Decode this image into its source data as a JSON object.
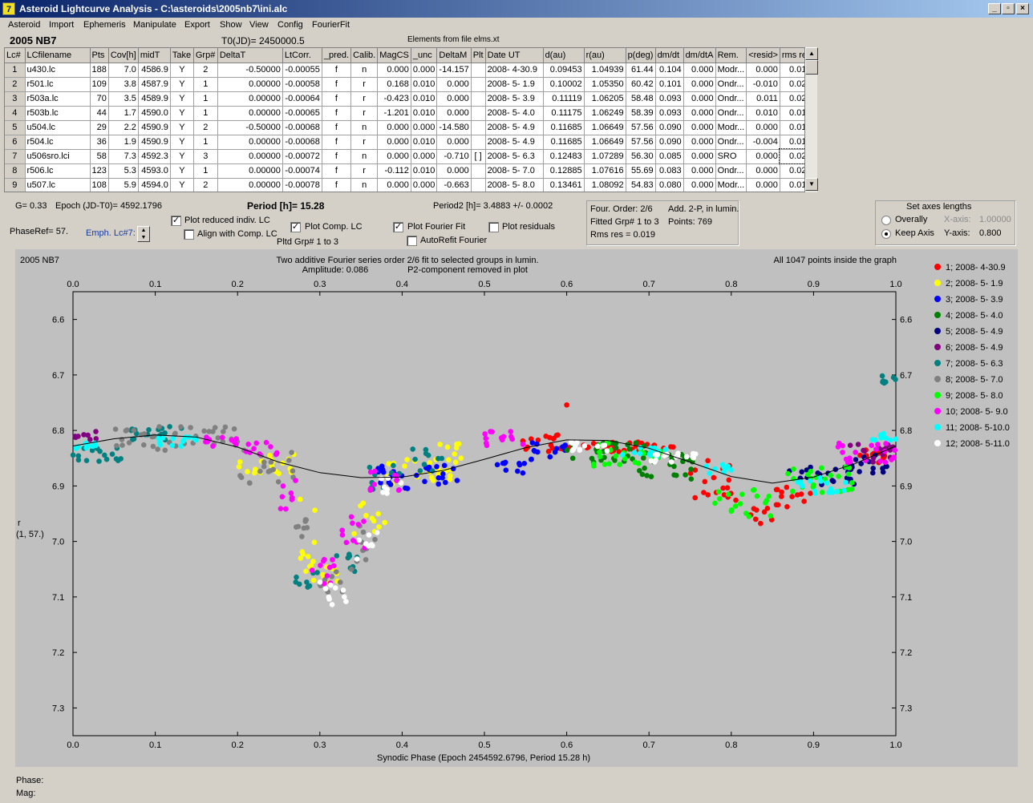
{
  "window": {
    "title": "Asteroid Lightcurve Analysis - C:\\asteroids\\2005nb7\\ini.alc",
    "min_label": "_",
    "max_label": "▫",
    "close_label": "×"
  },
  "menu": [
    "Asteroid",
    "Import",
    "Ephemeris",
    "Manipulate",
    "Export",
    "Show",
    "View",
    "Config",
    "FourierFit"
  ],
  "header": {
    "asteroid_name": "2005 NB7",
    "t0": "T0(JD)= 2450000.5",
    "elements": "Elements from file elms.xt"
  },
  "table": {
    "columns": [
      "Lc#",
      "LCfilename",
      "Pts",
      "Cov[h]",
      "midT",
      "Take",
      "Grp#",
      "DeltaT",
      "LtCorr.",
      "_pred.",
      "Calib.",
      "MagCS",
      "_unc",
      "DeltaM",
      "Plt",
      "Date UT",
      "d(au)",
      "r(au)",
      "p(deg)",
      "dm/dt",
      "dm/dtA",
      "Rem.",
      "<resid>",
      "rms res"
    ],
    "rows": [
      [
        "1",
        "u430.lc",
        "188",
        "7.0",
        "4586.9",
        "Y",
        "2",
        "-0.50000",
        "-0.00055",
        "f",
        "n",
        "0.000",
        "0.000",
        "-14.157",
        "",
        "2008- 4-30.9",
        "0.09453",
        "1.04939",
        "61.44",
        "0.104",
        "0.000",
        "Modr...",
        "0.000",
        "0.019"
      ],
      [
        "2",
        "r501.lc",
        "109",
        "3.8",
        "4587.9",
        "Y",
        "1",
        "0.00000",
        "-0.00058",
        "f",
        "r",
        "0.168",
        "0.010",
        "0.000",
        "",
        "2008- 5- 1.9",
        "0.10002",
        "1.05350",
        "60.42",
        "0.101",
        "0.000",
        "Ondr...",
        "-0.010",
        "0.023"
      ],
      [
        "3",
        "r503a.lc",
        "70",
        "3.5",
        "4589.9",
        "Y",
        "1",
        "0.00000",
        "-0.00064",
        "f",
        "r",
        "-0.423",
        "0.010",
        "0.000",
        "",
        "2008- 5- 3.9",
        "0.11119",
        "1.06205",
        "58.48",
        "0.093",
        "0.000",
        "Ondr...",
        "0.011",
        "0.022"
      ],
      [
        "4",
        "r503b.lc",
        "44",
        "1.7",
        "4590.0",
        "Y",
        "1",
        "0.00000",
        "-0.00065",
        "f",
        "r",
        "-1.201",
        "0.010",
        "0.000",
        "",
        "2008- 5- 4.0",
        "0.11175",
        "1.06249",
        "58.39",
        "0.093",
        "0.000",
        "Ondr...",
        "0.010",
        "0.017"
      ],
      [
        "5",
        "u504.lc",
        "29",
        "2.2",
        "4590.9",
        "Y",
        "2",
        "-0.50000",
        "-0.00068",
        "f",
        "n",
        "0.000",
        "0.000",
        "-14.580",
        "",
        "2008- 5- 4.9",
        "0.11685",
        "1.06649",
        "57.56",
        "0.090",
        "0.000",
        "Modr...",
        "0.000",
        "0.016"
      ],
      [
        "6",
        "r504.lc",
        "36",
        "1.9",
        "4590.9",
        "Y",
        "1",
        "0.00000",
        "-0.00068",
        "f",
        "r",
        "0.000",
        "0.010",
        "0.000",
        "",
        "2008- 5- 4.9",
        "0.11685",
        "1.06649",
        "57.56",
        "0.090",
        "0.000",
        "Ondr...",
        "-0.004",
        "0.014"
      ],
      [
        "7",
        "u506sro.lci",
        "58",
        "7.3",
        "4592.3",
        "Y",
        "3",
        "0.00000",
        "-0.00072",
        "f",
        "n",
        "0.000",
        "0.000",
        "-0.710",
        "[ ]",
        "2008- 5- 6.3",
        "0.12483",
        "1.07289",
        "56.30",
        "0.085",
        "0.000",
        "SRO",
        "0.000",
        "0.024"
      ],
      [
        "8",
        "r506.lc",
        "123",
        "5.3",
        "4593.0",
        "Y",
        "1",
        "0.00000",
        "-0.00074",
        "f",
        "r",
        "-0.112",
        "0.010",
        "0.000",
        "",
        "2008- 5- 7.0",
        "0.12885",
        "1.07616",
        "55.69",
        "0.083",
        "0.000",
        "Ondr...",
        "0.000",
        "0.022"
      ],
      [
        "9",
        "u507.lc",
        "108",
        "5.9",
        "4594.0",
        "Y",
        "2",
        "0.00000",
        "-0.00078",
        "f",
        "n",
        "0.000",
        "0.000",
        "-0.663",
        "",
        "2008- 5- 8.0",
        "0.13461",
        "1.08092",
        "54.83",
        "0.080",
        "0.000",
        "Modr...",
        "0.000",
        "0.014"
      ]
    ]
  },
  "controls": {
    "g": "G= 0.33",
    "epoch": "Epoch (JD-T0)= 4592.1796",
    "period": "Period [h]= 15.28",
    "period2": "Period2 [h]= 3.4883 +/- 0.0002",
    "phaseref": "PhaseRef= 57.",
    "emph": "Emph. Lc#7:",
    "plot_reduced": "Plot reduced indiv. LC",
    "align_comp": "Align with Comp. LC",
    "plot_comp": "Plot Comp. LC",
    "pltd_grp": "Pltd Grp#  1   to   3",
    "plot_fourier": "Plot Fourier Fit",
    "autorefit": "AutoRefit Fourier",
    "plot_residuals": "Plot residuals",
    "four_order": "Four. Order:  2/6",
    "add_2p": "Add. 2-P, in lumin.",
    "fitted_grp": "Fitted Grp# 1 to 3",
    "points": "Points: 769",
    "rms_res": "Rms res      = 0.019",
    "axes_title": "Set axes lengths",
    "overally": "Overally",
    "keep_axis": "Keep Axis",
    "x_axis": "X-axis:",
    "x_axis_val": "1.00000",
    "y_axis": "Y-axis:",
    "y_axis_val": "0.800"
  },
  "graph": {
    "name_label": "2005 NB7",
    "title1": "Two additive Fourier series order 2/6 fit to selected groups in lumin.",
    "title2a": "Amplitude: 0.086",
    "title2b": "P2-component removed in plot",
    "points_inside": "All 1047 points inside the graph",
    "y_label": "r",
    "y_label2": "(1, 57.)",
    "x_title": "Synodic Phase (Epoch 2454592.6796, Period 15.28 h)"
  },
  "chart_data": {
    "type": "scatter",
    "xlabel": "Synodic Phase (Epoch 2454592.6796, Period 15.28 h)",
    "ylabel": "r",
    "xlim": [
      0,
      1
    ],
    "ylim": [
      7.35,
      6.55
    ],
    "x_ticks": [
      "0.0",
      "0.1",
      "0.2",
      "0.3",
      "0.4",
      "0.5",
      "0.6",
      "0.7",
      "0.8",
      "0.9",
      "1.0"
    ],
    "y_ticks": [
      "6.6",
      "6.7",
      "6.8",
      "6.9",
      "7.0",
      "7.1",
      "7.2",
      "7.3"
    ],
    "fourier_fit": [
      [
        0.0,
        6.828
      ],
      [
        0.05,
        6.815
      ],
      [
        0.1,
        6.808
      ],
      [
        0.15,
        6.812
      ],
      [
        0.2,
        6.83
      ],
      [
        0.25,
        6.857
      ],
      [
        0.3,
        6.876
      ],
      [
        0.35,
        6.885
      ],
      [
        0.4,
        6.884
      ],
      [
        0.45,
        6.872
      ],
      [
        0.5,
        6.852
      ],
      [
        0.55,
        6.831
      ],
      [
        0.6,
        6.817
      ],
      [
        0.65,
        6.818
      ],
      [
        0.7,
        6.832
      ],
      [
        0.75,
        6.857
      ],
      [
        0.8,
        6.883
      ],
      [
        0.85,
        6.895
      ],
      [
        0.9,
        6.884
      ],
      [
        0.95,
        6.86
      ],
      [
        1.0,
        6.828
      ]
    ],
    "series": [
      {
        "name": "1; 2008- 4-30.9",
        "color": "#ff0000",
        "segments": [
          [
            0.54,
            0.6,
            6.8,
            6.84
          ],
          [
            0.6,
            0.73,
            6.82,
            6.84
          ],
          [
            0.75,
            0.82,
            6.85,
            6.93
          ],
          [
            0.82,
            0.85,
            6.92,
            6.98
          ],
          [
            0.85,
            0.9,
            6.9,
            6.94
          ],
          [
            0.95,
            1.0,
            6.83,
            6.86
          ]
        ]
      },
      {
        "name": "2; 2008- 5- 1.9",
        "color": "#ffff00",
        "segments": [
          [
            0.2,
            0.27,
            6.84,
            6.88
          ],
          [
            0.27,
            0.3,
            6.9,
            7.05
          ],
          [
            0.28,
            0.33,
            7.04,
            7.08
          ],
          [
            0.34,
            0.38,
            6.92,
            6.99
          ],
          [
            0.38,
            0.46,
            6.85,
            6.9
          ],
          [
            0.44,
            0.48,
            6.82,
            6.86
          ]
        ]
      },
      {
        "name": "3; 2008- 5- 3.9",
        "color": "#0000ff",
        "segments": [
          [
            0.37,
            0.44,
            6.86,
            6.91
          ],
          [
            0.43,
            0.47,
            6.86,
            6.9
          ],
          [
            0.51,
            0.55,
            6.84,
            6.88
          ],
          [
            0.55,
            0.6,
            6.82,
            6.86
          ]
        ]
      },
      {
        "name": "4; 2008- 5- 4.0",
        "color": "#008000",
        "segments": [
          [
            0.6,
            0.7,
            6.82,
            6.86
          ],
          [
            0.68,
            0.76,
            6.84,
            6.89
          ]
        ]
      },
      {
        "name": "5; 2008- 5- 4.9",
        "color": "#000080",
        "segments": [
          [
            0.87,
            0.95,
            6.86,
            6.9
          ],
          [
            0.93,
            0.99,
            6.84,
            6.88
          ]
        ]
      },
      {
        "name": "6; 2008- 5- 4.9",
        "color": "#800080",
        "segments": [
          [
            0.0,
            0.03,
            6.8,
            6.82
          ],
          [
            0.94,
            1.0,
            6.82,
            6.86
          ]
        ]
      },
      {
        "name": "7; 2008- 5- 6.3",
        "color": "#008080",
        "segments": [
          [
            0.0,
            0.06,
            6.83,
            6.86
          ],
          [
            0.07,
            0.14,
            6.79,
            6.82
          ],
          [
            0.27,
            0.3,
            7.05,
            7.09
          ],
          [
            0.32,
            0.35,
            7.02,
            7.06
          ],
          [
            0.36,
            0.4,
            6.86,
            6.92
          ],
          [
            0.41,
            0.45,
            6.83,
            6.88
          ],
          [
            0.98,
            1.0,
            6.7,
            6.72
          ]
        ]
      },
      {
        "name": "8; 2008- 5- 7.0",
        "color": "#808080",
        "segments": [
          [
            0.05,
            0.13,
            6.79,
            6.84
          ],
          [
            0.13,
            0.2,
            6.79,
            6.83
          ],
          [
            0.2,
            0.27,
            6.83,
            6.9
          ],
          [
            0.27,
            0.29,
            6.93,
            7.0
          ],
          [
            0.3,
            0.33,
            7.05,
            7.1
          ],
          [
            0.33,
            0.37,
            6.96,
            7.06
          ]
        ]
      },
      {
        "name": "9; 2008- 5- 8.0",
        "color": "#00ff00",
        "segments": [
          [
            0.63,
            0.72,
            6.82,
            6.87
          ],
          [
            0.78,
            0.85,
            6.9,
            6.96
          ],
          [
            0.86,
            0.95,
            6.86,
            6.92
          ]
        ]
      },
      {
        "name": "10; 2008- 5- 9.0",
        "color": "#ff00ff",
        "segments": [
          [
            0.16,
            0.2,
            6.81,
            6.83
          ],
          [
            0.21,
            0.25,
            6.82,
            6.85
          ],
          [
            0.25,
            0.28,
            6.88,
            6.95
          ],
          [
            0.28,
            0.32,
            7.03,
            7.08
          ],
          [
            0.32,
            0.36,
            6.95,
            7.02
          ],
          [
            0.36,
            0.4,
            6.87,
            6.92
          ],
          [
            0.5,
            0.55,
            6.8,
            6.83
          ],
          [
            0.92,
            1.0,
            6.82,
            6.86
          ]
        ]
      },
      {
        "name": "11; 2008- 5-10.0",
        "color": "#00ffff",
        "segments": [
          [
            0.0,
            0.04,
            6.82,
            6.84
          ],
          [
            0.1,
            0.15,
            6.81,
            6.83
          ],
          [
            0.66,
            0.72,
            6.83,
            6.85
          ],
          [
            0.76,
            0.8,
            6.86,
            6.88
          ],
          [
            0.88,
            0.94,
            6.88,
            6.92
          ],
          [
            0.96,
            1.0,
            6.8,
            6.82
          ]
        ]
      },
      {
        "name": "12; 2008- 5-11.0",
        "color": "#ffffff",
        "segments": [
          [
            0.3,
            0.34,
            7.07,
            7.12
          ],
          [
            0.34,
            0.37,
            6.98,
            7.05
          ],
          [
            0.37,
            0.4,
            6.88,
            6.92
          ],
          [
            0.6,
            0.65,
            6.82,
            6.84
          ],
          [
            0.7,
            0.76,
            6.84,
            6.86
          ]
        ]
      }
    ],
    "special_points": [
      [
        0.6,
        6.754,
        "#ff0000"
      ]
    ]
  },
  "status": {
    "phase_label": "Phase:",
    "mag_label": "Mag:"
  }
}
